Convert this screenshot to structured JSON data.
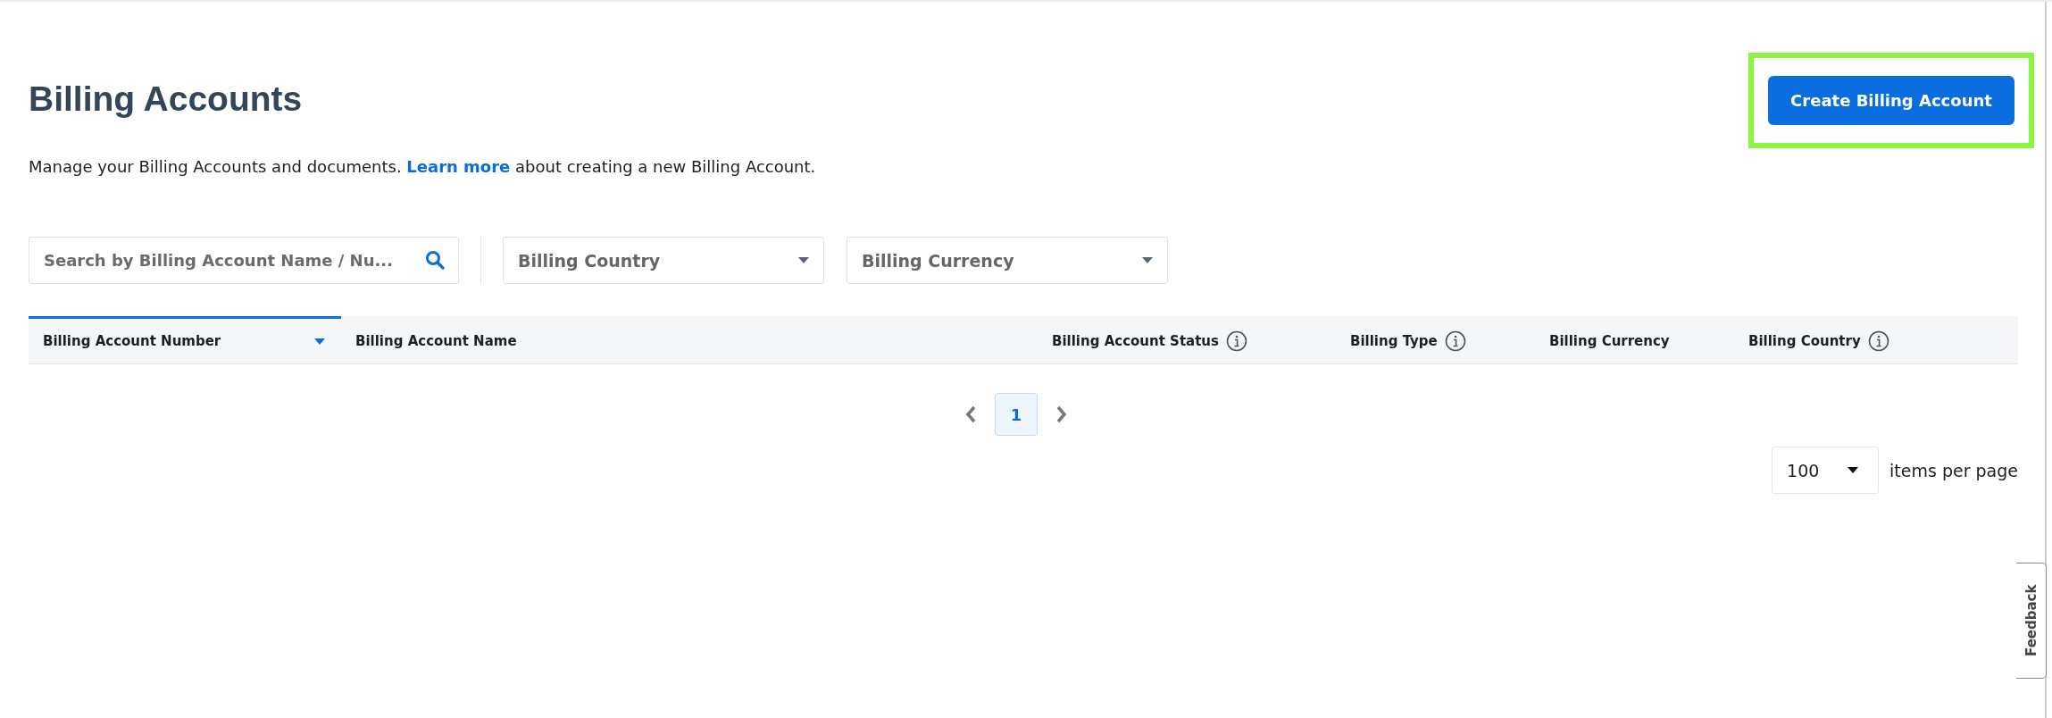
{
  "header": {
    "title": "Billing Accounts",
    "description_before": "Manage your Billing Accounts and documents.",
    "description_link": "Learn more",
    "description_after": "about creating a new Billing Account.",
    "create_button": "Create Billing Account",
    "create_button_highlighted": true
  },
  "filters": {
    "search": {
      "placeholder": "Search by Billing Account Name / Nu..."
    },
    "dropdowns": [
      {
        "placeholder": "Billing Country"
      },
      {
        "placeholder": "Billing Currency"
      }
    ]
  },
  "table": {
    "columns": [
      {
        "label": "Billing Account Number",
        "sorted": true,
        "info": false
      },
      {
        "label": "Billing Account Name",
        "sorted": false,
        "info": false
      },
      {
        "label": "Billing Account Status",
        "sorted": false,
        "info": true
      },
      {
        "label": "Billing Type",
        "sorted": false,
        "info": true
      },
      {
        "label": "Billing Currency",
        "sorted": false,
        "info": false
      },
      {
        "label": "Billing Country",
        "sorted": false,
        "info": true
      }
    ]
  },
  "pagination": {
    "pages": [
      {
        "label": "1",
        "selected": true
      }
    ],
    "per_page": "100",
    "per_page_label": "items per page"
  },
  "feedback_tab": "Feedback"
}
